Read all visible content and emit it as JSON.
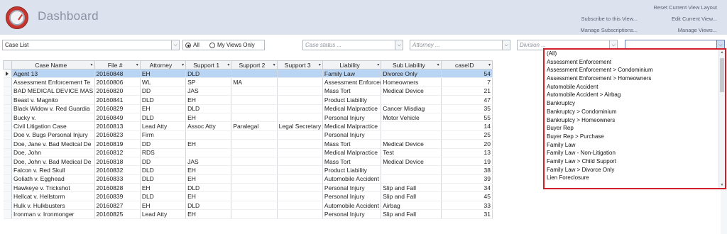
{
  "app": {
    "title": "Dashboard"
  },
  "header_links": {
    "reset": "Reset Current View Layout",
    "subscribe": "Subscribe to this View...",
    "edit": "Edit Current View...",
    "manage_subs": "Manage Subscriptions...",
    "manage_views": "Manage Views..."
  },
  "toolbar": {
    "view_select": "Case List",
    "radio_all": "All",
    "radio_mine": "My Views Only",
    "case_status_ph": "Case status ...",
    "attorney_ph": "Attorney ...",
    "division_ph": "Division ...",
    "liability_value": ""
  },
  "grid": {
    "columns": [
      "Case Name",
      "File #",
      "Attorney",
      "Support 1",
      "Support 2",
      "Support 3",
      "Liability",
      "Sub Liability",
      "caseID"
    ],
    "rows": [
      [
        "Agent 13",
        "20160848",
        "EH",
        "DLD",
        "",
        "",
        "Family Law",
        "Divorce Only",
        "54"
      ],
      [
        "Assessment Enforcement Te",
        "20160806",
        "WL",
        "SP",
        "MA",
        "",
        "Assessment Enforcement",
        "Homeowners",
        "7"
      ],
      [
        "BAD MEDICAL DEVICE MAS",
        "20160820",
        "DD",
        "JAS",
        "",
        "",
        "Mass Tort",
        "Medical Device",
        "21"
      ],
      [
        "Beast v. Magnito",
        "20160841",
        "DLD",
        "EH",
        "",
        "",
        "Product Liability",
        "",
        "47"
      ],
      [
        "Black Widow v. Red Guardia",
        "20160829",
        "EH",
        "DLD",
        "",
        "",
        "Medical Malpractice",
        "Cancer Misdiag",
        "35"
      ],
      [
        "Bucky v.",
        "20160849",
        "DLD",
        "EH",
        "",
        "",
        "Personal Injury",
        "Motor Vehicle",
        "55"
      ],
      [
        "Civil Litigation Case",
        "20160813",
        "Lead Atty",
        "Assoc Atty",
        "Paralegal",
        "Legal Secretary",
        "Medical Malpractice",
        "",
        "14"
      ],
      [
        "Doe v. Bugs Personal Injury",
        "20160823",
        "Firm",
        "",
        "",
        "",
        "Personal Injury",
        "",
        "25"
      ],
      [
        "Doe, Jane v. Bad Medical De",
        "20160819",
        "DD",
        "EH",
        "",
        "",
        "Mass Tort",
        "Medical Device",
        "20"
      ],
      [
        "Doe, John",
        "20160812",
        "RDS",
        "",
        "",
        "",
        "Medical Malpractice",
        "Test",
        "13"
      ],
      [
        "Doe, John v. Bad Medical De",
        "20160818",
        "DD",
        "JAS",
        "",
        "",
        "Mass Tort",
        "Medical Device",
        "19"
      ],
      [
        "Falcon v. Red Skull",
        "20160832",
        "DLD",
        "EH",
        "",
        "",
        "Product Liability",
        "",
        "38"
      ],
      [
        "Goliath v. Egghead",
        "20160833",
        "DLD",
        "EH",
        "",
        "",
        "Automobile Accident",
        "",
        "39"
      ],
      [
        "Hawkeye v. Trickshot",
        "20160828",
        "EH",
        "DLD",
        "",
        "",
        "Personal Injury",
        "Slip and Fall",
        "34"
      ],
      [
        "Hellcat v. Hellstorm",
        "20160839",
        "DLD",
        "EH",
        "",
        "",
        "Personal Injury",
        "Slip and Fall",
        "45"
      ],
      [
        "Hulk v. Hulkbusters",
        "20160827",
        "EH",
        "DLD",
        "",
        "",
        "Automobile Accident",
        "Airbag",
        "33"
      ],
      [
        "Ironman v. Ironmonger",
        "20160825",
        "Lead Atty",
        "EH",
        "",
        "",
        "Personal Injury",
        "Slip and Fall",
        "31"
      ]
    ]
  },
  "liability_dropdown": {
    "items": [
      "(All)",
      "Assessment Enforcement",
      "Assessment Enforcement > Condominium",
      "Assessment Enforcement > Homeowners",
      "Automobile Accident",
      "Automobile Accident > Airbag",
      "Bankruptcy",
      "Bankruptcy > Condominium",
      "Bankruptcy > Homeowners",
      "Buyer Rep",
      "Buyer Rep > Purchase",
      "Family Law",
      "Family Law - Non-Litigation",
      "Family Law > Child Support",
      "Family Law > Divorce Only",
      "Lien Foreclosure"
    ]
  },
  "colors": {
    "header_bg": "#dde3ee",
    "selected_row": "#b9d5f3",
    "highlight_border": "#d0202a",
    "logo": "#c6362e"
  }
}
